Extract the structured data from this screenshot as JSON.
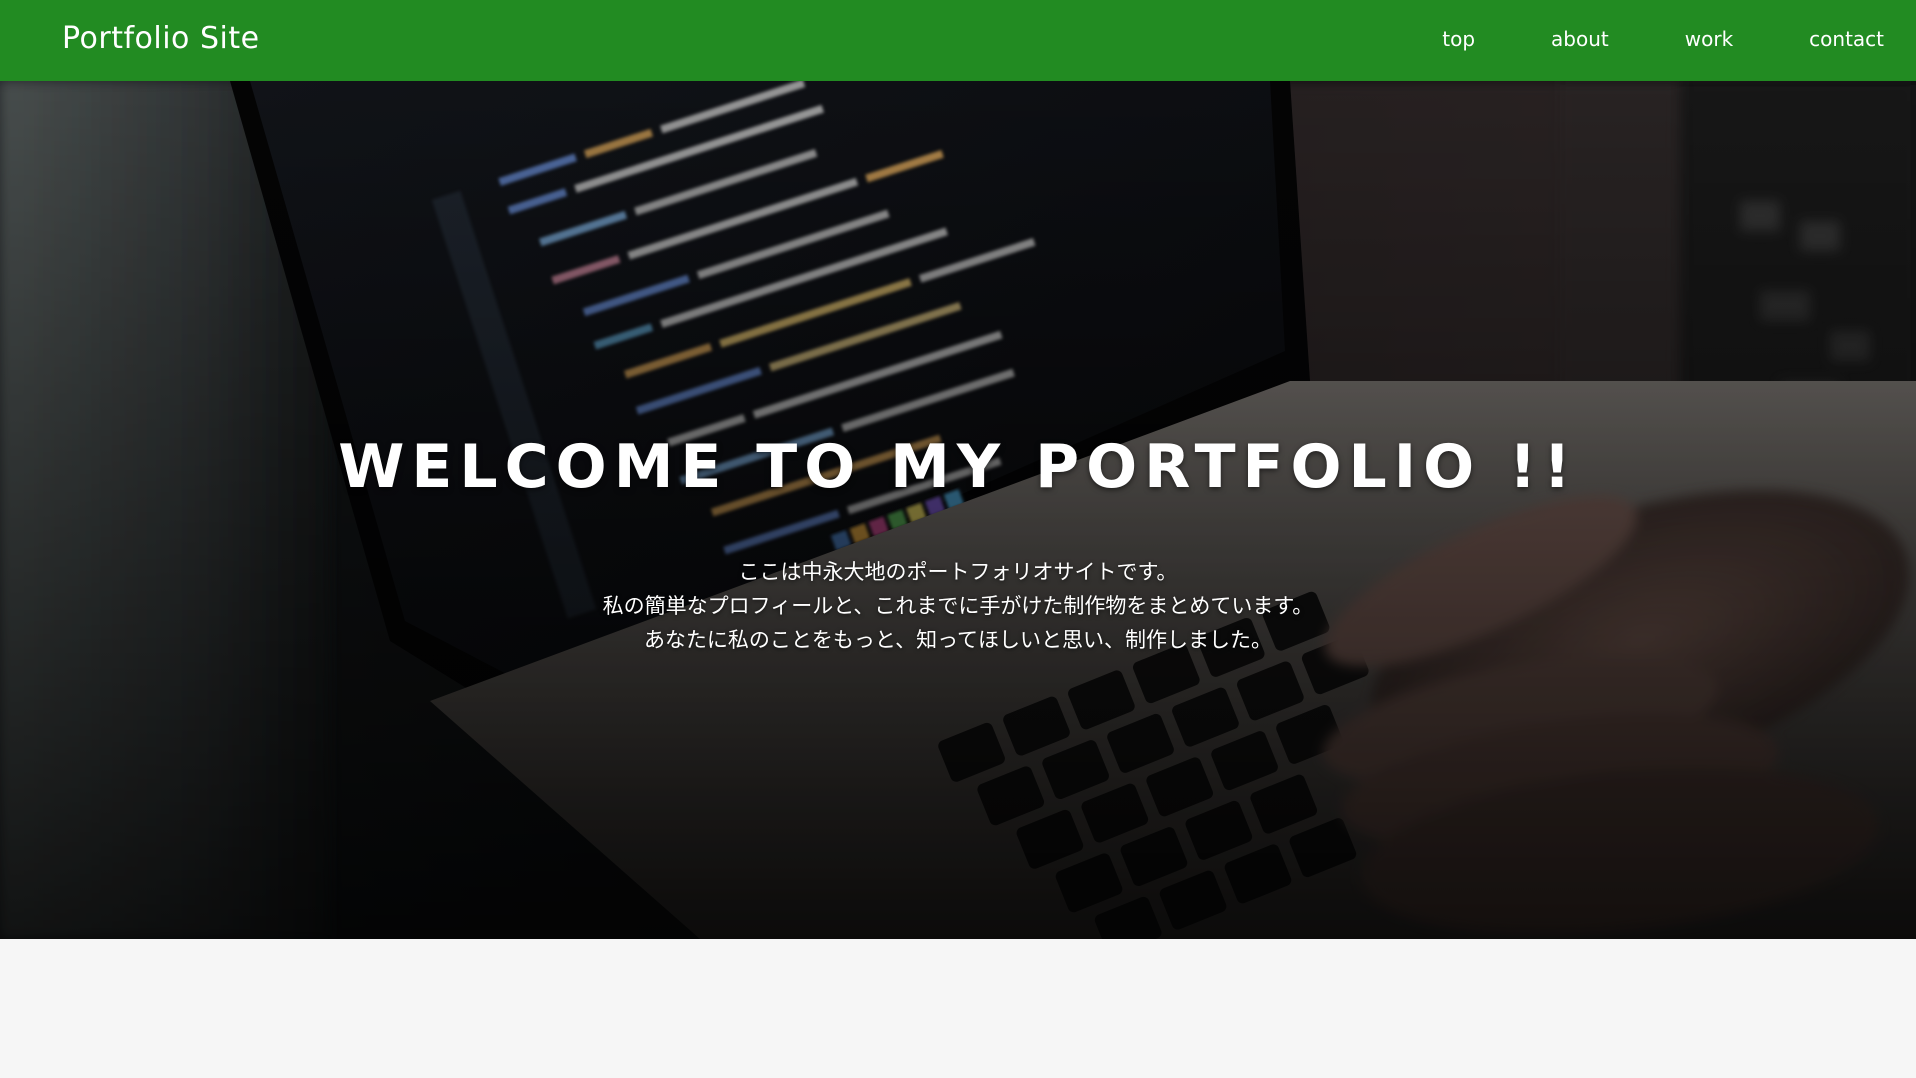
{
  "header": {
    "logo": "Portfolio Site",
    "nav": [
      {
        "label": "top"
      },
      {
        "label": "about"
      },
      {
        "label": "work"
      },
      {
        "label": "contact"
      }
    ]
  },
  "hero": {
    "title": "WELCOME TO MY PORTFOLIO !!",
    "lines": [
      "ここは中永大地のポートフォリオサイトです。",
      "私の簡単なプロフィールと、これまでに手がけた制作物をまとめています。",
      "あなたに私のことをもっと、知ってほしいと思い、制作しました。"
    ],
    "background_image": "laptop-code-photo"
  },
  "colors": {
    "header_bg": "#228b22",
    "header_text": "#ffffff",
    "page_bg": "#f6f6f6"
  }
}
